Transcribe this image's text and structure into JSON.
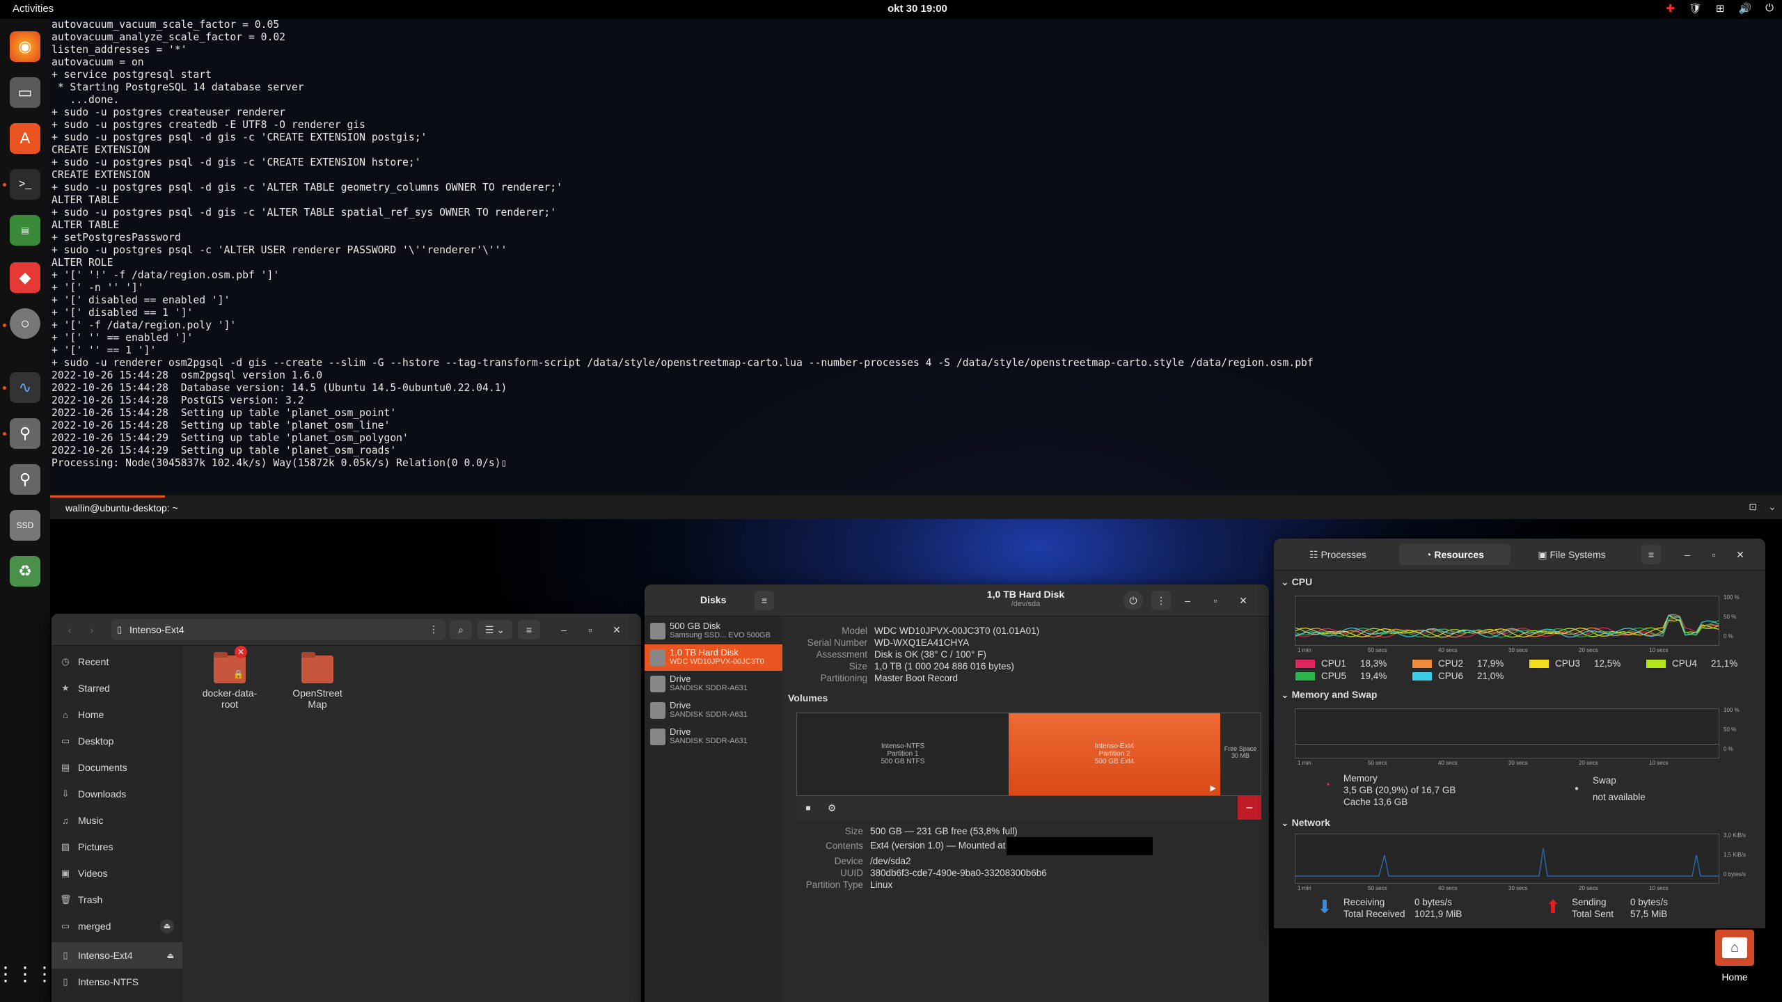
{
  "topbar": {
    "activities": "Activities",
    "clock": "okt 30  19:00",
    "tray": [
      "✚",
      "🛡",
      "⊞",
      "🔊",
      "⏻"
    ]
  },
  "terminal": {
    "lines": [
      "autovacuum_vacuum_scale_factor = 0.05",
      "autovacuum_analyze_scale_factor = 0.02",
      "",
      "listen_addresses = '*'",
      "autovacuum = on",
      "+ service postgresql start",
      " * Starting PostgreSQL 14 database server",
      "   ...done.",
      "+ sudo -u postgres createuser renderer",
      "+ sudo -u postgres createdb -E UTF8 -O renderer gis",
      "+ sudo -u postgres psql -d gis -c 'CREATE EXTENSION postgis;'",
      "CREATE EXTENSION",
      "+ sudo -u postgres psql -d gis -c 'CREATE EXTENSION hstore;'",
      "CREATE EXTENSION",
      "+ sudo -u postgres psql -d gis -c 'ALTER TABLE geometry_columns OWNER TO renderer;'",
      "ALTER TABLE",
      "+ sudo -u postgres psql -d gis -c 'ALTER TABLE spatial_ref_sys OWNER TO renderer;'",
      "ALTER TABLE",
      "+ setPostgresPassword",
      "+ sudo -u postgres psql -c 'ALTER USER renderer PASSWORD '\\''renderer'\\'''",
      "ALTER ROLE",
      "+ '[' '!' -f /data/region.osm.pbf ']'",
      "+ '[' -n '' ']'",
      "+ '[' disabled == enabled ']'",
      "+ '[' disabled == 1 ']'",
      "+ '[' -f /data/region.poly ']'",
      "+ '[' '' == enabled ']'",
      "+ '[' '' == 1 ']'",
      "+ sudo -u renderer osm2pgsql -d gis --create --slim -G --hstore --tag-transform-script /data/style/openstreetmap-carto.lua --number-processes 4 -S /data/style/openstreetmap-carto.style /data/region.osm.pbf",
      "2022-10-26 15:44:28  osm2pgsql version 1.6.0",
      "2022-10-26 15:44:28  Database version: 14.5 (Ubuntu 14.5-0ubuntu0.22.04.1)",
      "2022-10-26 15:44:28  PostGIS version: 3.2",
      "2022-10-26 15:44:28  Setting up table 'planet_osm_point'",
      "2022-10-26 15:44:28  Setting up table 'planet_osm_line'",
      "2022-10-26 15:44:29  Setting up table 'planet_osm_polygon'",
      "2022-10-26 15:44:29  Setting up table 'planet_osm_roads'",
      "Processing: Node(3045837k 102.4k/s) Way(15872k 0.05k/s) Relation(0 0.0/s)▯"
    ],
    "tab_title": "wallin@ubuntu-desktop: ~"
  },
  "dock": {
    "home_label": "Home"
  },
  "files": {
    "path": "Intenso-Ext4",
    "sidebar": [
      "Recent",
      "Starred",
      "Home",
      "Desktop",
      "Documents",
      "Downloads",
      "Music",
      "Pictures",
      "Videos",
      "Trash",
      "merged",
      "Intenso-Ext4",
      "Intenso-NTFS"
    ],
    "folders": [
      {
        "name": "docker-data-root"
      },
      {
        "name": "OpenStreet Map"
      }
    ]
  },
  "disks": {
    "app_title": "Disks",
    "title": "1,0 TB Hard Disk",
    "subtitle": "/dev/sda",
    "list": [
      {
        "name": "500 GB Disk",
        "sub": "Samsung SSD...   EVO 500GB"
      },
      {
        "name": "1,0 TB Hard Disk",
        "sub": "WDC WD10JPVX-00JC3T0"
      },
      {
        "name": "Drive",
        "sub": "SANDISK SDDR-A631"
      },
      {
        "name": "Drive",
        "sub": "SANDISK SDDR-A631"
      },
      {
        "name": "Drive",
        "sub": "SANDISK SDDR-A631"
      }
    ],
    "info": {
      "model_k": "Model",
      "model": "WDC WD10JPVX-00JC3T0 (01.01A01)",
      "serial_k": "Serial Number",
      "serial": "WD-WXQ1EA41CHYA",
      "assess_k": "Assessment",
      "assess": "Disk is OK (38° C / 100° F)",
      "size_k": "Size",
      "size": "1,0 TB (1 000 204 886 016 bytes)",
      "part_k": "Partitioning",
      "part": "Master Boot Record"
    },
    "volumes_label": "Volumes",
    "volumes": [
      {
        "name": "Intenso-NTFS",
        "l2": "Partition 1",
        "l3": "500 GB NTFS"
      },
      {
        "name": "Intenso-Ext4",
        "l2": "Partition 2",
        "l3": "500 GB Ext4"
      },
      {
        "name": "Free Space",
        "l2": "30 MB",
        "l3": ""
      }
    ],
    "vol": {
      "size_k": "Size",
      "size": "500 GB — 231 GB free (53,8% full)",
      "contents_k": "Contents",
      "contents": "Ext4 (version 1.0) — Mounted at",
      "device_k": "Device",
      "device": "/dev/sda2",
      "uuid_k": "UUID",
      "uuid": "380db6f3-cde7-490e-9ba0-33208300b6b6",
      "ptype_k": "Partition Type",
      "ptype": "Linux"
    }
  },
  "sysmon": {
    "tabs": [
      "Processes",
      "Resources",
      "File Systems"
    ],
    "cpu_label": "CPU",
    "cpus": [
      {
        "name": "CPU1",
        "val": "18,3%",
        "color": "#e0245e"
      },
      {
        "name": "CPU2",
        "val": "17,9%",
        "color": "#f08c3c"
      },
      {
        "name": "CPU3",
        "val": "12,5%",
        "color": "#f5dc1e"
      },
      {
        "name": "CPU4",
        "val": "21,1%",
        "color": "#b4e61e"
      },
      {
        "name": "CPU5",
        "val": "19,4%",
        "color": "#2cb44c"
      },
      {
        "name": "CPU6",
        "val": "21,0%",
        "color": "#3ccde6"
      }
    ],
    "mem_label": "Memory and Swap",
    "memory": {
      "title": "Memory",
      "l1": "3,5 GB (20,9%) of 16,7 GB",
      "l2": "Cache 13,6 GB"
    },
    "swap": {
      "title": "Swap",
      "l1": "not available"
    },
    "net_label": "Network",
    "recv": {
      "title": "Receiving",
      "rate": "0 bytes/s",
      "total_k": "Total Received",
      "total": "1021,9 MiB"
    },
    "send": {
      "title": "Sending",
      "rate": "0 bytes/s",
      "total_k": "Total Sent",
      "total": "57,5 MiB"
    },
    "xticks": [
      "1 min",
      "50 secs",
      "40 secs",
      "30 secs",
      "20 secs",
      "10 secs"
    ],
    "pct_ticks": [
      "100 %",
      "50 %",
      "0 %"
    ],
    "net_ticks": [
      "3,0 KiB/s",
      "1,5 KiB/s",
      "0 bytes/s"
    ]
  }
}
